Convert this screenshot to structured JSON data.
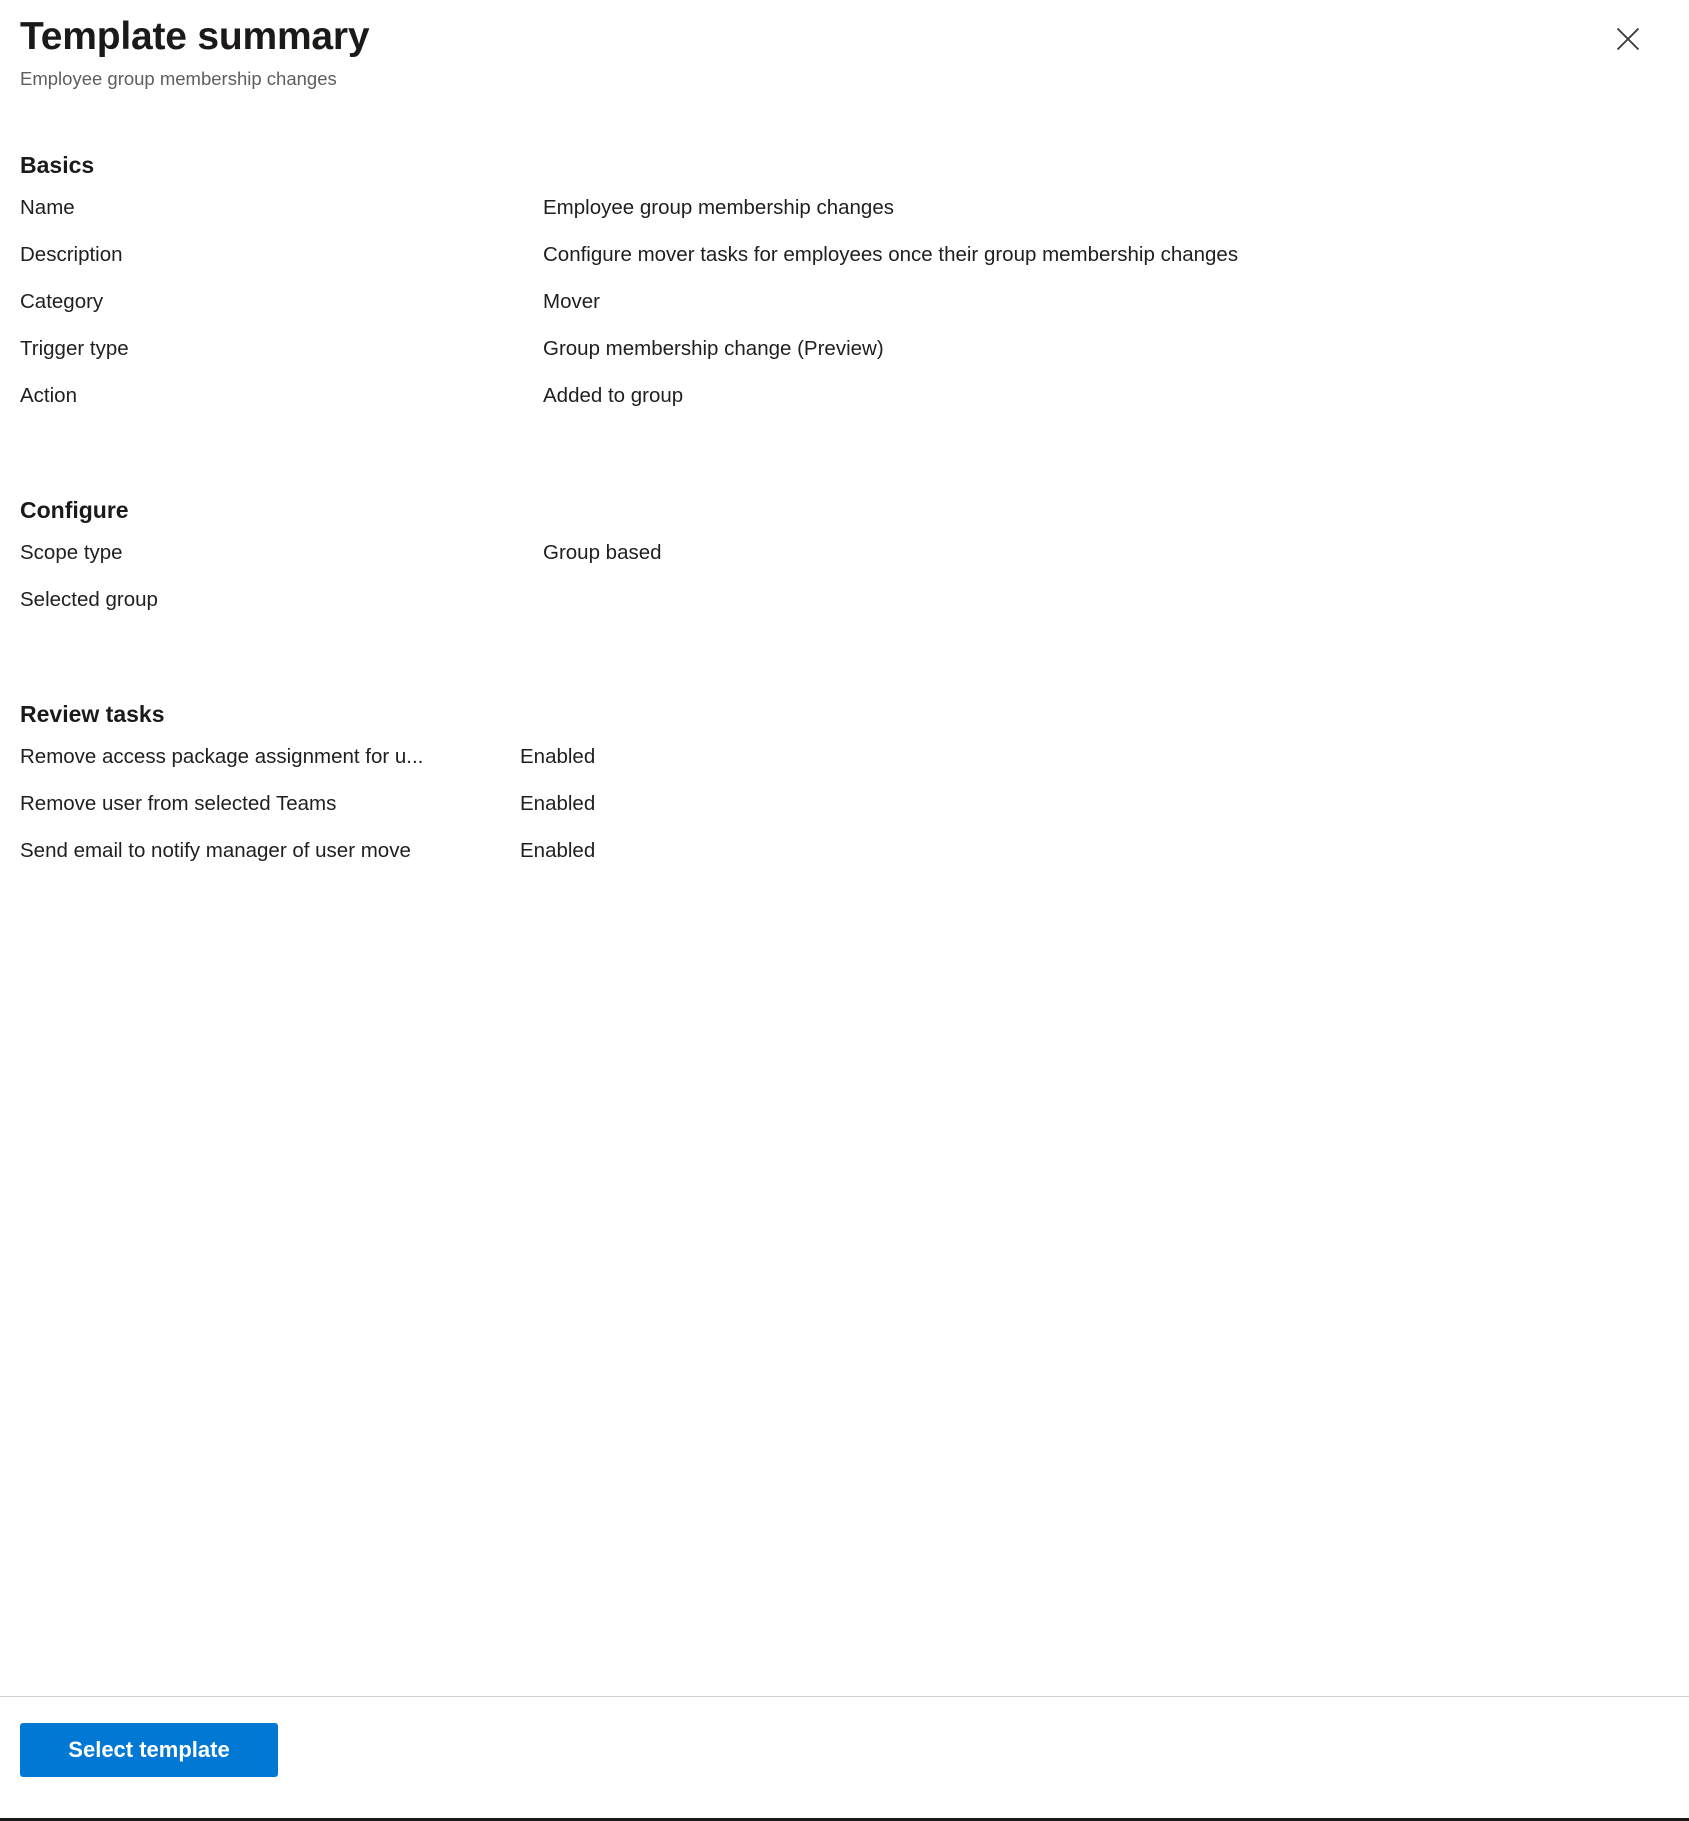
{
  "header": {
    "title": "Template summary",
    "subtitle": "Employee group membership changes",
    "close_label": "Close"
  },
  "sections": [
    {
      "title": "Basics",
      "rows": [
        {
          "key": "Name",
          "value": "Employee group membership changes"
        },
        {
          "key": "Description",
          "value": "Configure mover tasks for employees once their group membership changes"
        },
        {
          "key": "Category",
          "value": "Mover"
        },
        {
          "key": "Trigger type",
          "value": "Group membership change (Preview)"
        },
        {
          "key": "Action",
          "value": "Added to group"
        }
      ]
    },
    {
      "title": "Configure",
      "rows": [
        {
          "key": "Scope type",
          "value": "Group based"
        },
        {
          "key": "Selected group",
          "value": ""
        }
      ]
    },
    {
      "title": "Review tasks",
      "rows": [
        {
          "key": "Remove access package assignment for u...",
          "value": "Enabled"
        },
        {
          "key": "Remove user from selected Teams",
          "value": "Enabled"
        },
        {
          "key": "Send email to notify manager of user move",
          "value": "Enabled"
        }
      ]
    }
  ],
  "footer": {
    "primary_button": "Select template"
  },
  "colors": {
    "accent": "#0078d4",
    "text": "#201f1e",
    "muted_text": "#605e5c",
    "divider": "#d2d0ce",
    "background": "#ffffff"
  }
}
